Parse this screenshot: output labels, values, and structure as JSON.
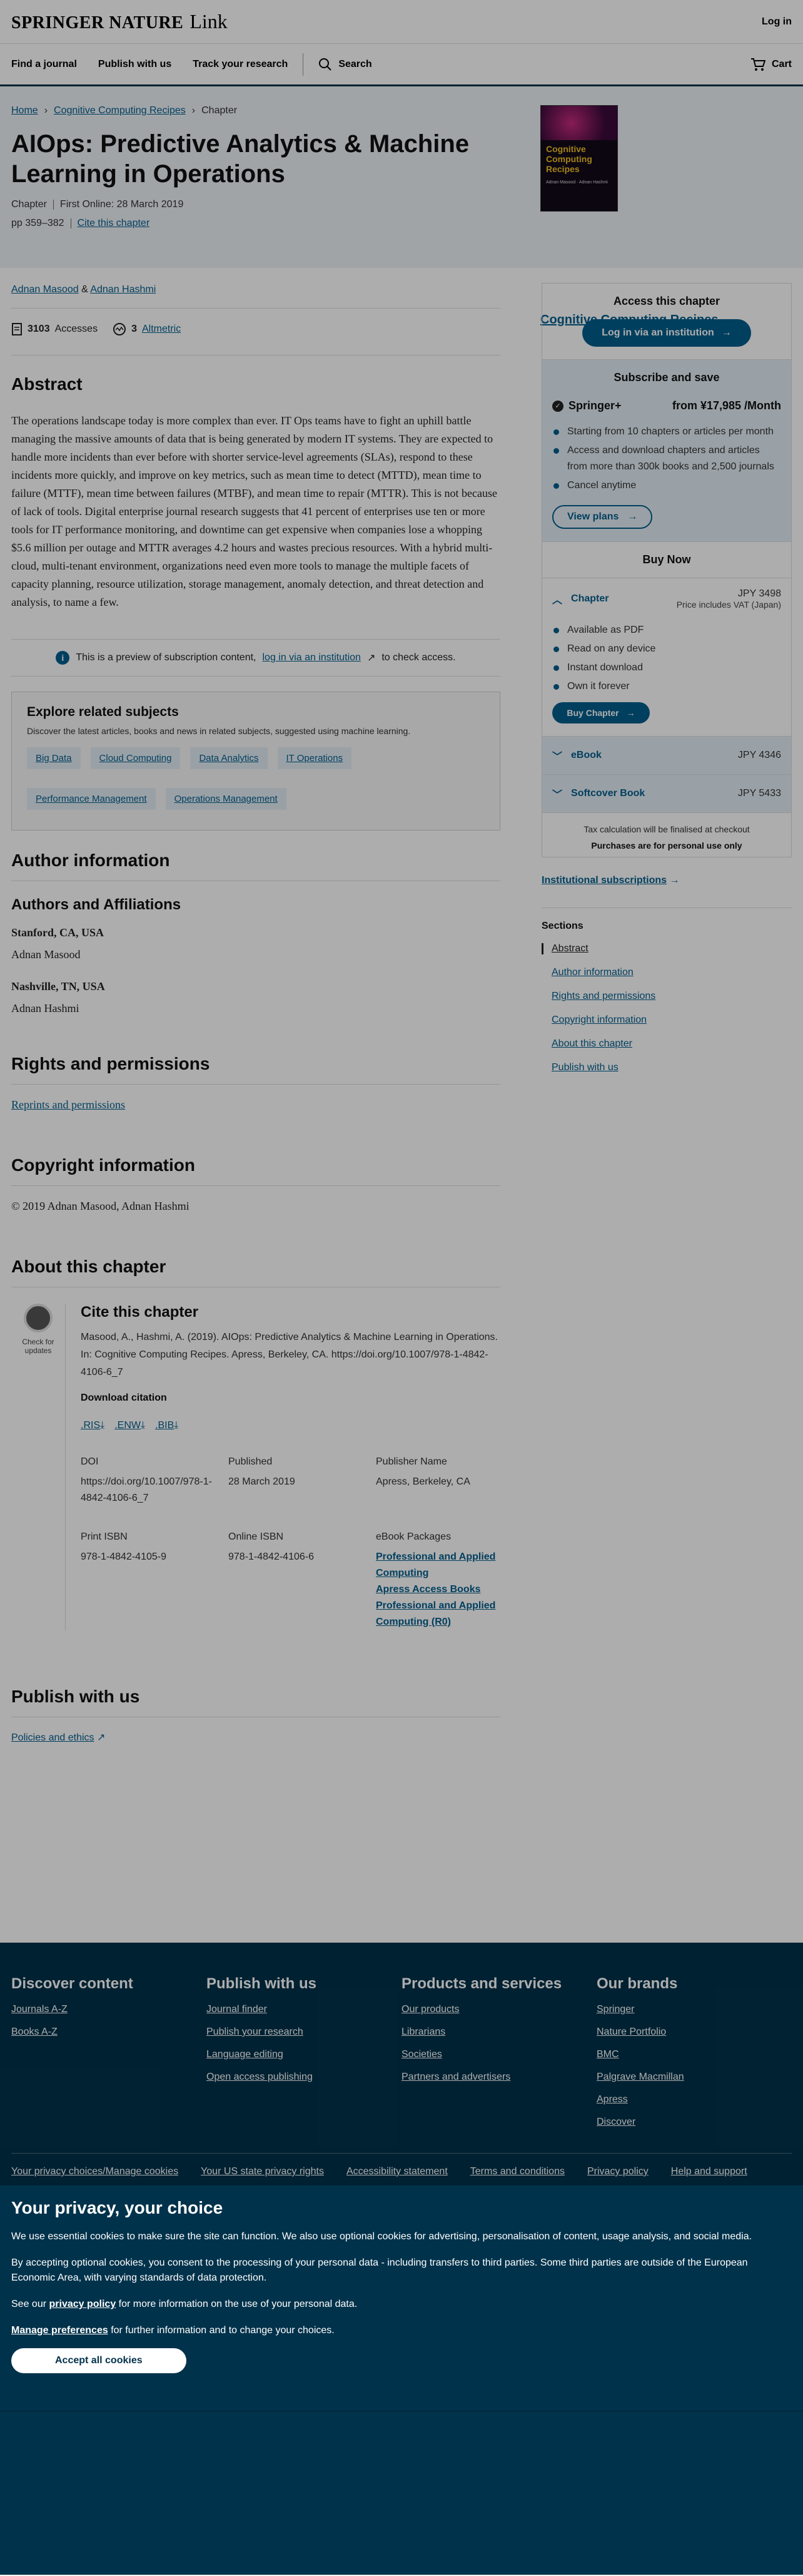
{
  "header": {
    "brand": "SPRINGER NATURE",
    "brand_suffix": "Link",
    "login": "Log in"
  },
  "nav": {
    "items": [
      "Find a journal",
      "Publish with us",
      "Track your research"
    ],
    "search": "Search",
    "cart": "Cart"
  },
  "breadcrumb": [
    "Home",
    "Cognitive Computing Recipes",
    "Chapter"
  ],
  "article": {
    "title": "AIOps: Predictive Analytics & Machine Learning in Operations",
    "type": "Chapter",
    "online": "First Online: 28 March 2019",
    "pages": "pp 359–382",
    "cite_link": "Cite this chapter",
    "book_title": "Cognitive Computing Recipes",
    "cover_title": "Cognitive Computing Recipes",
    "cover_author": "Adnan Masood · Adnan Hashmi"
  },
  "authors": {
    "a1": "Adnan Masood",
    "amp": "&",
    "a2": "Adnan Hashmi"
  },
  "metrics": {
    "accesses_count": "3103",
    "accesses_label": "Accesses",
    "altmetric_count": "3",
    "altmetric_label": "Altmetric"
  },
  "abstract": {
    "heading": "Abstract",
    "text": "The operations landscape today is more complex than ever. IT Ops teams have to fight an uphill battle managing the massive amounts of data that is being generated by modern IT systems. They are expected to handle more incidents than ever before with shorter service-level agreements (SLAs), respond to these incidents more quickly, and improve on key metrics, such as mean time to detect (MTTD), mean time to failure (MTTF), mean time between failures (MTBF), and mean time to repair (MTTR). This is not because of lack of tools. Digital enterprise journal research suggests that 41 percent of enterprises use ten or more tools for IT performance monitoring, and downtime can get expensive when companies lose a whopping $5.6 million per outage and MTTR averages 4.2 hours and wastes precious resources. With a hybrid multi-cloud, multi-tenant environment, organizations need even more tools to manage the multiple facets of capacity planning, resource utilization, storage management, anomaly detection, and threat detection and analysis, to name a few."
  },
  "preview": {
    "pre": "This is a preview of subscription content,",
    "link": "log in via an institution",
    "post": "to check access."
  },
  "explore": {
    "title": "Explore related subjects",
    "desc": "Discover the latest articles, books and news in related subjects, suggested using machine learning.",
    "chips": [
      "Big Data",
      "Cloud Computing",
      "Data Analytics",
      "IT Operations",
      "Performance Management",
      "Operations Management"
    ]
  },
  "author_info": {
    "heading": "Author information",
    "sub": "Authors and Affiliations",
    "loc1": "Stanford, CA, USA",
    "name1": "Adnan Masood",
    "loc2": "Nashville, TN, USA",
    "name2": "Adnan Hashmi"
  },
  "rights": {
    "heading": "Rights and permissions",
    "link": "Reprints and permissions"
  },
  "copyright": {
    "heading": "Copyright information",
    "text": "© 2019 Adnan Masood, Adnan Hashmi"
  },
  "about": {
    "heading": "About this chapter",
    "badge": "Check for updates",
    "cite_heading": "Cite this chapter",
    "cite_text": "Masood, A., Hashmi, A. (2019). AIOps: Predictive Analytics & Machine Learning in Operations. In: Cognitive Computing Recipes. Apress, Berkeley, CA. https://doi.org/10.1007/978-1-4842-4106-6_7",
    "download": "Download citation",
    "formats": [
      ".RIS",
      ".ENW",
      ".BIB"
    ],
    "doi_label": "DOI",
    "doi": "https://doi.org/10.1007/978-1-4842-4106-6_7",
    "published_label": "Published",
    "published": "28 March 2019",
    "publisher_label": "Publisher Name",
    "publisher": "Apress, Berkeley, CA",
    "print_isbn_label": "Print ISBN",
    "print_isbn": "978-1-4842-4105-9",
    "online_isbn_label": "Online ISBN",
    "online_isbn": "978-1-4842-4106-6",
    "packages_label": "eBook Packages",
    "packages": [
      "Professional and Applied Computing",
      "Apress Access Books",
      "Professional and Applied Computing (R0)"
    ]
  },
  "publish": {
    "heading": "Publish with us",
    "link": "Policies and ethics"
  },
  "sidebar": {
    "access_heading": "Access this chapter",
    "login_btn": "Log in via an institution",
    "sub_heading": "Subscribe and save",
    "springer_plus": "Springer+",
    "price": "from ¥17,985 /Month",
    "sub_bullets": [
      "Starting from 10 chapters or articles per month",
      "Access and download chapters and articles from more than 300k books and 2,500 journals",
      "Cancel anytime"
    ],
    "view_plans": "View plans",
    "buy_now": "Buy Now",
    "chapter_label": "Chapter",
    "chapter_price": "JPY 3498",
    "vat": "Price includes VAT (Japan)",
    "chapter_bullets": [
      "Available as PDF",
      "Read on any device",
      "Instant download",
      "Own it forever"
    ],
    "buy_chapter": "Buy Chapter",
    "ebook_label": "eBook",
    "ebook_price": "JPY 4346",
    "softcover_label": "Softcover Book",
    "softcover_price": "JPY 5433",
    "tax": "Tax calculation will be finalised at checkout",
    "personal": "Purchases are for personal use only",
    "inst_subs": "Institutional subscriptions",
    "sections_heading": "Sections",
    "sections": [
      "Abstract",
      "Author information",
      "Rights and permissions",
      "Copyright information",
      "About this chapter",
      "Publish with us"
    ]
  },
  "footer": {
    "cols": [
      {
        "title": "Discover content",
        "links": [
          "Journals A-Z",
          "Books A-Z"
        ]
      },
      {
        "title": "Publish with us",
        "links": [
          "Journal finder",
          "Publish your research",
          "Language editing",
          "Open access publishing"
        ]
      },
      {
        "title": "Products and services",
        "links": [
          "Our products",
          "Librarians",
          "Societies",
          "Partners and advertisers"
        ]
      },
      {
        "title": "Our brands",
        "links": [
          "Springer",
          "Nature Portfolio",
          "BMC",
          "Palgrave Macmillan",
          "Apress",
          "Discover"
        ]
      }
    ],
    "bottom": [
      "Your privacy choices/Manage cookies",
      "Your US state privacy rights",
      "Accessibility statement",
      "Terms and conditions",
      "Privacy policy",
      "Help and support"
    ]
  },
  "cookie": {
    "title": "Your privacy, your choice",
    "p1": "We use essential cookies to make sure the site can function. We also use optional cookies for advertising, personalisation of content, usage analysis, and social media.",
    "p2": "By accepting optional cookies, you consent to the processing of your personal data - including transfers to third parties. Some third parties are outside of the European Economic Area, with varying standards of data protection.",
    "p3_pre": "See our",
    "p3_link": "privacy policy",
    "p3_post": "for more information on the use of your personal data.",
    "p4_link": "Manage preferences",
    "p4_post": "for further information and to change your choices.",
    "accept": "Accept all cookies"
  }
}
